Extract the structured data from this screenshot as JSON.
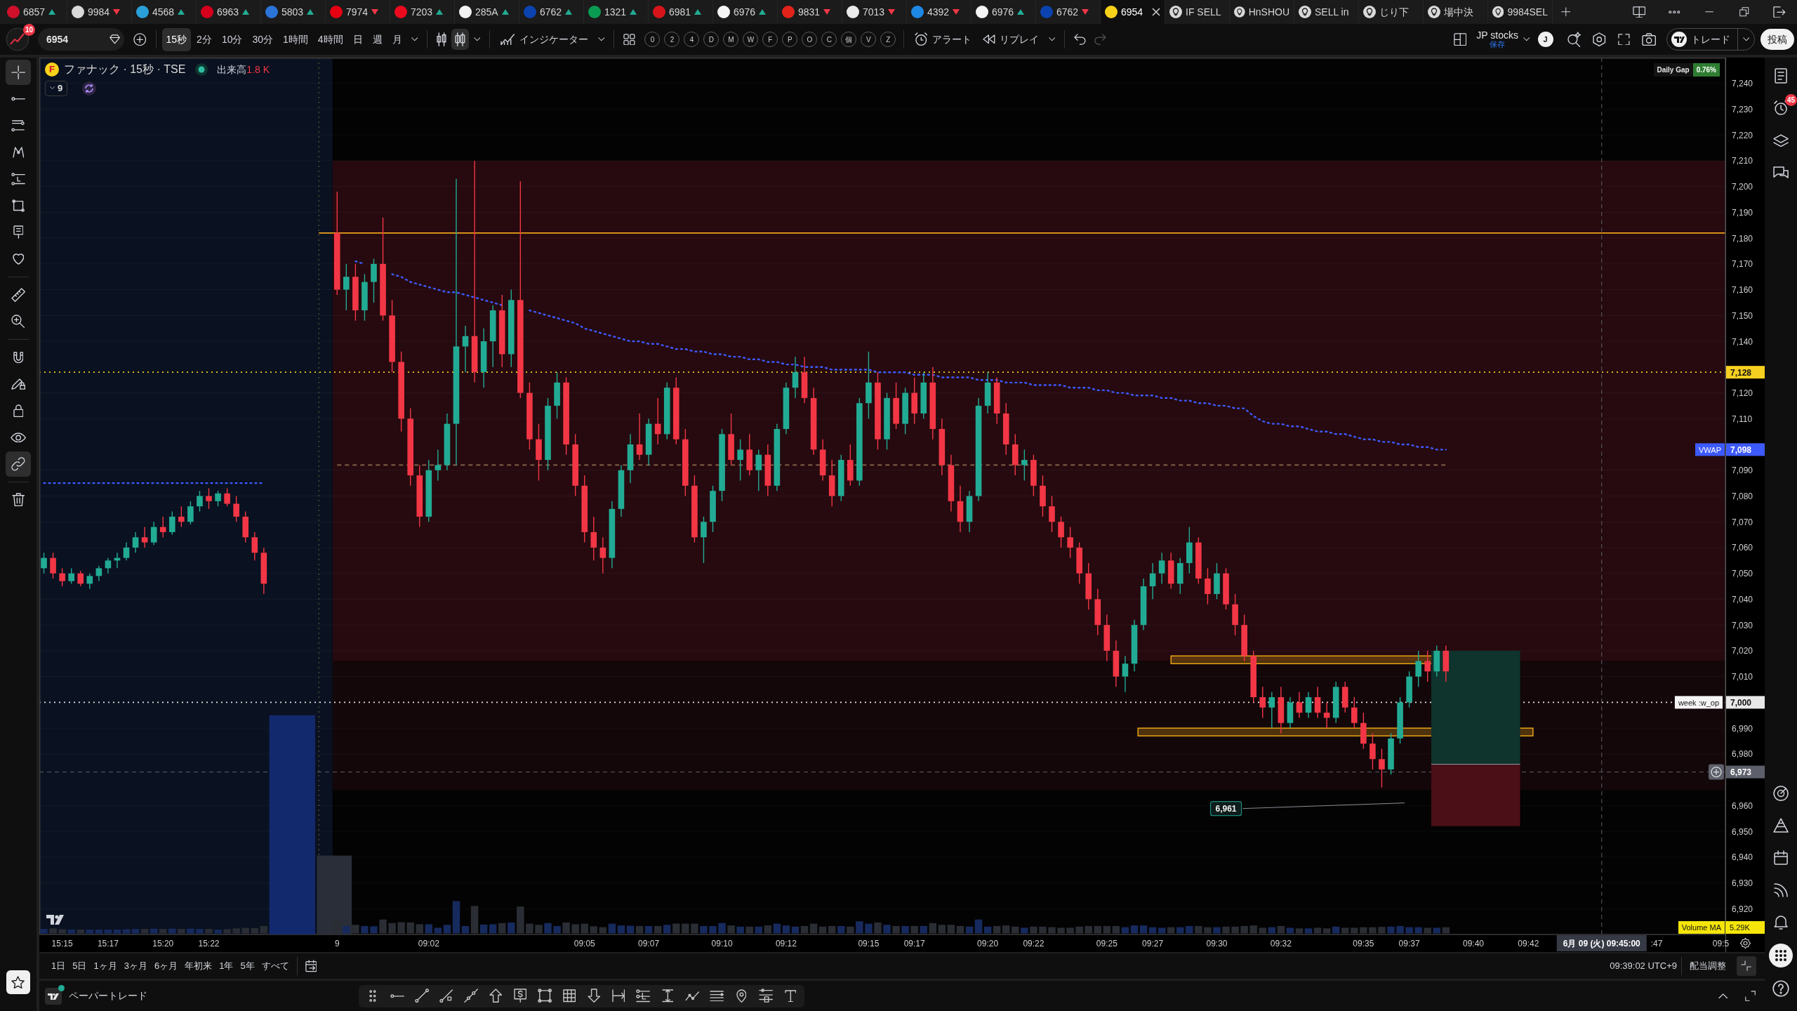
{
  "tabs": [
    {
      "kind": "symbol",
      "symbol": "6857",
      "rising": true,
      "color": "#d0102b",
      "selected": false
    },
    {
      "kind": "symbol",
      "symbol": "9984",
      "rising": false,
      "color": "#d9d9d9",
      "selected": false
    },
    {
      "kind": "symbol",
      "symbol": "4568",
      "rising": true,
      "color": "#2a9fd8",
      "selected": false
    },
    {
      "kind": "symbol",
      "symbol": "6963",
      "rising": true,
      "color": "#d6001c",
      "selected": false
    },
    {
      "kind": "symbol",
      "symbol": "5803",
      "rising": true,
      "color": "#2b74d8",
      "selected": false
    },
    {
      "kind": "symbol",
      "symbol": "7974",
      "rising": false,
      "color": "#e60012",
      "selected": false
    },
    {
      "kind": "symbol",
      "symbol": "7203",
      "rising": true,
      "color": "#eb0a1e",
      "selected": false
    },
    {
      "kind": "symbol",
      "symbol": "285A",
      "rising": true,
      "color": "#f2f2f2",
      "selected": false
    },
    {
      "kind": "symbol",
      "symbol": "6762",
      "rising": true,
      "color": "#0b43b0",
      "selected": false
    },
    {
      "kind": "symbol",
      "symbol": "1321",
      "rising": true,
      "color": "#0a9b52",
      "selected": false
    },
    {
      "kind": "symbol",
      "symbol": "6981",
      "rising": true,
      "color": "#d7141a",
      "selected": false
    },
    {
      "kind": "symbol",
      "symbol": "6976",
      "rising": true,
      "color": "#f5f5f5",
      "selected": false
    },
    {
      "kind": "symbol",
      "symbol": "9831",
      "rising": false,
      "color": "#e2231a",
      "selected": false
    },
    {
      "kind": "symbol",
      "symbol": "7013",
      "rising": false,
      "color": "#ebebeb",
      "selected": false
    },
    {
      "kind": "symbol",
      "symbol": "4392",
      "rising": false,
      "color": "#1e88e5",
      "selected": false
    },
    {
      "kind": "symbol",
      "symbol": "6976",
      "rising": true,
      "color": "#f5f5f5",
      "selected": false
    },
    {
      "kind": "symbol",
      "symbol": "6762",
      "rising": false,
      "color": "#0b43b0",
      "selected": false
    },
    {
      "kind": "symbol",
      "symbol": "6954",
      "color": "#f7d21b",
      "selected": true
    },
    {
      "kind": "layout",
      "title": "IF SELL",
      "selected": false
    },
    {
      "kind": "layout",
      "title": "HnSHOU",
      "selected": false
    },
    {
      "kind": "layout",
      "title": "SELL in",
      "selected": false
    },
    {
      "kind": "layout",
      "title": "じり下",
      "selected": false
    },
    {
      "kind": "layout",
      "title": "場中決",
      "selected": false
    },
    {
      "kind": "layout",
      "title": "9984SEL",
      "selected": false
    }
  ],
  "toolbar": {
    "profile_badge": "10",
    "symbol": "6954",
    "intervals": [
      {
        "label": "15秒",
        "selected": true
      },
      {
        "label": "2分",
        "selected": false
      },
      {
        "label": "10分",
        "selected": false
      },
      {
        "label": "30分",
        "selected": false
      },
      {
        "label": "1時間",
        "selected": false
      },
      {
        "label": "4時間",
        "selected": false
      },
      {
        "label": "日",
        "selected": false
      },
      {
        "label": "週",
        "selected": false
      },
      {
        "label": "月",
        "selected": false
      }
    ],
    "chart_types": [
      {
        "selected": false
      },
      {
        "selected": true
      }
    ],
    "indicators": "インジケーター",
    "favorites": [
      "0",
      "2",
      "4",
      "D",
      "M",
      "W",
      "F",
      "P",
      "O",
      "C",
      "個",
      "V",
      "Z"
    ],
    "alert": "アラート",
    "replay": "リプレイ",
    "undo": {
      "disabled": false
    },
    "redo": {
      "disabled": true
    },
    "layout_name": "JP stocks",
    "layout_status": "保存",
    "avatar": "J",
    "trade": "トレード",
    "publish": "投稿"
  },
  "drawing_tools": [
    {
      "selected": true
    },
    {
      "selected": false
    },
    {
      "selected": false
    },
    {
      "selected": false
    },
    {
      "selected": false
    },
    {
      "selected": false
    },
    {
      "selected": false
    },
    {
      "selected": false
    },
    {
      "selected": false
    },
    {
      "selected": false
    },
    {
      "selected": false
    },
    {
      "selected": false
    },
    {
      "selected": false
    },
    {
      "selected": false
    },
    {
      "selected": true
    },
    {
      "selected": false
    }
  ],
  "favorites_button": {
    "selected": true
  },
  "chart": {
    "logo": "F",
    "title": "ファナック · 15秒 · TSE",
    "market_open": true,
    "volume_label": "出来高",
    "volume_value": "1.8 K",
    "indicators_count": "9",
    "daily_gap": {
      "label": "Daily Gap",
      "value": "0.76%"
    },
    "volume_ma": {
      "label": "Volume MA",
      "value": "5.29K"
    },
    "chart_data": [
      {
        "type": "candlestick",
        "categories": [
          null,
          null,
          "15:15",
          null,
          null,
          null,
          null,
          "15:17",
          null,
          null,
          null,
          null,
          null,
          "15:20",
          null,
          null,
          null,
          null,
          "15:22",
          null,
          null,
          null,
          null,
          null,
          null,
          null,
          null,
          null,
          null,
          null,
          null,
          null,
          "9",
          null,
          null,
          null,
          null,
          null,
          null,
          null,
          null,
          null,
          "09:02",
          null,
          null,
          null,
          null,
          null,
          null,
          null,
          null,
          null,
          null,
          null,
          null,
          null,
          null,
          null,
          null,
          "09:05",
          null,
          null,
          null,
          null,
          null,
          null,
          "09:07",
          null,
          null,
          null,
          null,
          null,
          null,
          null,
          "09:10",
          null,
          null,
          null,
          null,
          null,
          null,
          "09:12",
          null,
          null,
          null,
          null,
          null,
          null,
          null,
          null,
          "09:15",
          null,
          null,
          null,
          null,
          "09:17",
          null,
          null,
          null,
          null,
          null,
          null,
          null,
          "09:20",
          null,
          null,
          null,
          null,
          "09:22",
          null,
          null,
          null,
          null,
          null,
          null,
          null,
          "09:25",
          null,
          null,
          null,
          null,
          "09:27",
          null,
          null,
          null,
          null,
          null,
          null,
          "09:30",
          null,
          null,
          null,
          null,
          null,
          null,
          "09:32",
          null,
          null,
          null,
          null,
          null,
          null,
          null,
          null,
          "09:35",
          null,
          null,
          null,
          null,
          "09:37",
          null,
          null,
          null,
          null,
          null,
          null,
          "09:40",
          null,
          null,
          null,
          null,
          null,
          "09:42",
          null,
          null,
          null,
          null,
          null,
          null,
          null,
          null,
          null,
          null,
          null,
          null,
          null,
          ":47",
          null,
          null,
          null,
          null,
          null,
          null,
          "09:5"
        ],
        "ohlc": [
          [
            7052,
            7058,
            7050,
            7056
          ],
          [
            7056,
            7058,
            7048,
            7050
          ],
          [
            7050,
            7052,
            7045,
            7047
          ],
          [
            7047,
            7052,
            7046,
            7050
          ],
          [
            7050,
            7051,
            7045,
            7046
          ],
          [
            7046,
            7050,
            7044,
            7049
          ],
          [
            7049,
            7053,
            7047,
            7052
          ],
          [
            7052,
            7056,
            7050,
            7055
          ],
          [
            7055,
            7058,
            7052,
            7056
          ],
          [
            7056,
            7062,
            7055,
            7060
          ],
          [
            7060,
            7066,
            7058,
            7064
          ],
          [
            7064,
            7068,
            7060,
            7062
          ],
          [
            7062,
            7070,
            7061,
            7068
          ],
          [
            7068,
            7072,
            7064,
            7066
          ],
          [
            7066,
            7074,
            7065,
            7072
          ],
          [
            7072,
            7076,
            7068,
            7070
          ],
          [
            7070,
            7078,
            7069,
            7076
          ],
          [
            7076,
            7082,
            7074,
            7080
          ],
          [
            7080,
            7083,
            7075,
            7078
          ],
          [
            7078,
            7082,
            7076,
            7081
          ],
          [
            7081,
            7083,
            7076,
            7077
          ],
          [
            7077,
            7080,
            7070,
            7072
          ],
          [
            7072,
            7074,
            7062,
            7064
          ],
          [
            7064,
            7066,
            7055,
            7058
          ],
          [
            7058,
            7060,
            7042,
            7046
          ],
          null,
          null,
          null,
          null,
          null,
          null,
          null,
          [
            7182,
            7198,
            7158,
            7160
          ],
          [
            7160,
            7170,
            7152,
            7165
          ],
          [
            7165,
            7170,
            7148,
            7152
          ],
          [
            7152,
            7166,
            7148,
            7163
          ],
          [
            7163,
            7172,
            7155,
            7170
          ],
          [
            7170,
            7188,
            7148,
            7150
          ],
          [
            7150,
            7156,
            7128,
            7132
          ],
          [
            7132,
            7136,
            7105,
            7110
          ],
          [
            7110,
            7114,
            7084,
            7088
          ],
          [
            7088,
            7092,
            7068,
            7072
          ],
          [
            7072,
            7094,
            7070,
            7090
          ],
          [
            7090,
            7098,
            7086,
            7092
          ],
          [
            7092,
            7112,
            7090,
            7108
          ],
          [
            7108,
            7203,
            7092,
            7138
          ],
          [
            7138,
            7146,
            7128,
            7142
          ],
          [
            7142,
            7210,
            7124,
            7128
          ],
          [
            7128,
            7145,
            7122,
            7140
          ],
          [
            7140,
            7154,
            7130,
            7152
          ],
          [
            7152,
            7158,
            7130,
            7135
          ],
          [
            7135,
            7160,
            7130,
            7156
          ],
          [
            7156,
            7202,
            7118,
            7120
          ],
          [
            7120,
            7124,
            7098,
            7102
          ],
          [
            7102,
            7108,
            7086,
            7094
          ],
          [
            7094,
            7118,
            7090,
            7115
          ],
          [
            7115,
            7128,
            7110,
            7124
          ],
          [
            7124,
            7126,
            7096,
            7100
          ],
          [
            7100,
            7104,
            7080,
            7084
          ],
          [
            7084,
            7088,
            7062,
            7066
          ],
          [
            7066,
            7072,
            7055,
            7060
          ],
          [
            7060,
            7064,
            7050,
            7056
          ],
          [
            7056,
            7078,
            7052,
            7075
          ],
          [
            7075,
            7092,
            7072,
            7090
          ],
          [
            7090,
            7104,
            7085,
            7100
          ],
          [
            7100,
            7112,
            7094,
            7096
          ],
          [
            7096,
            7110,
            7092,
            7108
          ],
          [
            7108,
            7118,
            7100,
            7104
          ],
          [
            7104,
            7124,
            7102,
            7122
          ],
          [
            7122,
            7126,
            7100,
            7102
          ],
          [
            7102,
            7106,
            7080,
            7084
          ],
          [
            7084,
            7088,
            7062,
            7064
          ],
          [
            7064,
            7072,
            7054,
            7070
          ],
          [
            7070,
            7084,
            7066,
            7082
          ],
          [
            7082,
            7106,
            7078,
            7104
          ],
          [
            7104,
            7112,
            7092,
            7094
          ],
          [
            7094,
            7102,
            7086,
            7098
          ],
          [
            7098,
            7104,
            7088,
            7090
          ],
          [
            7090,
            7098,
            7082,
            7096
          ],
          [
            7096,
            7100,
            7080,
            7084
          ],
          [
            7084,
            7108,
            7082,
            7106
          ],
          [
            7106,
            7124,
            7104,
            7122
          ],
          [
            7122,
            7134,
            7118,
            7128
          ],
          [
            7128,
            7134,
            7116,
            7118
          ],
          [
            7118,
            7122,
            7096,
            7098
          ],
          [
            7098,
            7102,
            7086,
            7088
          ],
          [
            7088,
            7094,
            7076,
            7080
          ],
          [
            7080,
            7096,
            7078,
            7094
          ],
          [
            7094,
            7100,
            7084,
            7086
          ],
          [
            7086,
            7118,
            7084,
            7116
          ],
          [
            7116,
            7136,
            7110,
            7124
          ],
          [
            7124,
            7128,
            7098,
            7102
          ],
          [
            7102,
            7120,
            7098,
            7118
          ],
          [
            7118,
            7124,
            7106,
            7108
          ],
          [
            7108,
            7122,
            7104,
            7120
          ],
          [
            7120,
            7126,
            7108,
            7112
          ],
          [
            7112,
            7128,
            7110,
            7124
          ],
          [
            7124,
            7130,
            7102,
            7106
          ],
          [
            7106,
            7110,
            7088,
            7092
          ],
          [
            7092,
            7096,
            7074,
            7078
          ],
          [
            7078,
            7084,
            7066,
            7070
          ],
          [
            7070,
            7082,
            7066,
            7080
          ],
          [
            7080,
            7118,
            7078,
            7115
          ],
          [
            7115,
            7128,
            7112,
            7124
          ],
          [
            7124,
            7126,
            7108,
            7112
          ],
          [
            7112,
            7116,
            7096,
            7100
          ],
          [
            7100,
            7104,
            7088,
            7092
          ],
          [
            7092,
            7098,
            7086,
            7094
          ],
          [
            7094,
            7096,
            7080,
            7084
          ],
          [
            7084,
            7088,
            7072,
            7076
          ],
          [
            7076,
            7080,
            7066,
            7070
          ],
          [
            7070,
            7072,
            7060,
            7064
          ],
          [
            7064,
            7068,
            7056,
            7060
          ],
          [
            7060,
            7062,
            7046,
            7050
          ],
          [
            7050,
            7054,
            7036,
            7040
          ],
          [
            7040,
            7044,
            7026,
            7030
          ],
          [
            7030,
            7034,
            7016,
            7020
          ],
          [
            7020,
            7024,
            7006,
            7010
          ],
          [
            7010,
            7018,
            7004,
            7015
          ],
          [
            7015,
            7032,
            7012,
            7030
          ],
          [
            7030,
            7048,
            7028,
            7045
          ],
          [
            7045,
            7054,
            7040,
            7050
          ],
          [
            7050,
            7058,
            7046,
            7055
          ],
          [
            7055,
            7058,
            7044,
            7046
          ],
          [
            7046,
            7056,
            7042,
            7054
          ],
          [
            7054,
            7068,
            7050,
            7062
          ],
          [
            7062,
            7064,
            7046,
            7048
          ],
          [
            7048,
            7052,
            7038,
            7042
          ],
          [
            7042,
            7054,
            7040,
            7050
          ],
          [
            7050,
            7052,
            7036,
            7038
          ],
          [
            7038,
            7042,
            7026,
            7030
          ],
          [
            7030,
            7034,
            7016,
            7018
          ],
          [
            7018,
            7020,
            7000,
            7002
          ],
          [
            7002,
            7006,
            6994,
            6998
          ],
          [
            6998,
            7004,
            6990,
            7002
          ],
          [
            7002,
            7006,
            6988,
            6992
          ],
          [
            6992,
            7002,
            6990,
            7000
          ],
          [
            7000,
            7004,
            6994,
            6996
          ],
          [
            6996,
            7004,
            6994,
            7002
          ],
          [
            7002,
            7006,
            6994,
            6996
          ],
          [
            6996,
            7000,
            6990,
            6994
          ],
          [
            6994,
            7008,
            6992,
            7006
          ],
          [
            7006,
            7008,
            6996,
            6998
          ],
          [
            6998,
            7002,
            6990,
            6992
          ],
          [
            6992,
            6996,
            6982,
            6984
          ],
          [
            6984,
            6988,
            6974,
            6978
          ],
          [
            6978,
            6982,
            6967,
            6974
          ],
          [
            6974,
            6988,
            6972,
            6986
          ],
          [
            6986,
            7002,
            6984,
            7000
          ],
          [
            7000,
            7012,
            6998,
            7010
          ],
          [
            7010,
            7020,
            7006,
            7016
          ],
          [
            7016,
            7020,
            7008,
            7012
          ],
          [
            7012,
            7022,
            7010,
            7020
          ],
          [
            7020,
            7022,
            7008,
            7012
          ],
          null,
          null,
          null,
          null,
          null,
          null,
          null,
          null,
          null,
          null,
          null,
          null,
          null,
          null,
          null,
          null,
          null,
          null,
          null,
          null,
          null,
          null,
          null,
          null,
          null,
          null,
          null,
          null,
          null,
          null
        ],
        "ylim": [
          6910,
          7250
        ],
        "yticks": [
          {
            "value": 7240,
            "label": "7,240"
          },
          {
            "value": 7230,
            "label": "7,230"
          },
          {
            "value": 7220,
            "label": "7,220"
          },
          {
            "value": 7210,
            "label": "7,210"
          },
          {
            "value": 7200,
            "label": "7,200"
          },
          {
            "value": 7190,
            "label": "7,190"
          },
          {
            "value": 7180,
            "label": "7,180"
          },
          {
            "value": 7170,
            "label": "7,170"
          },
          {
            "value": 7160,
            "label": "7,160"
          },
          {
            "value": 7150,
            "label": "7,150"
          },
          {
            "value": 7140,
            "label": "7,140"
          },
          {
            "value": 7120,
            "label": "7,120"
          },
          {
            "value": 7110,
            "label": "7,110"
          },
          {
            "value": 7090,
            "label": "7,090"
          },
          {
            "value": 7080,
            "label": "7,080"
          },
          {
            "value": 7070,
            "label": "7,070"
          },
          {
            "value": 7060,
            "label": "7,060"
          },
          {
            "value": 7050,
            "label": "7,050"
          },
          {
            "value": 7040,
            "label": "7,040"
          },
          {
            "value": 7030,
            "label": "7,030"
          },
          {
            "value": 7020,
            "label": "7,020"
          },
          {
            "value": 7010,
            "label": "7,010"
          },
          {
            "value": 6990,
            "label": "6,990"
          },
          {
            "value": 6980,
            "label": "6,980"
          },
          {
            "value": 6960,
            "label": "6,960"
          },
          {
            "value": 6950,
            "label": "6,950"
          },
          {
            "value": 6940,
            "label": "6,940"
          },
          {
            "value": 6930,
            "label": "6,930"
          },
          {
            "value": 6920,
            "label": "6,920"
          }
        ],
        "grid": true,
        "series": [
          {
            "name": "VWAP",
            "type": "line",
            "color": "#3d5afe",
            "line_style": "dotted",
            "values": [
              7085,
              7085,
              7085,
              7085,
              7085,
              7085,
              7085,
              7085,
              7085,
              7085,
              7085,
              7085,
              7085,
              7085,
              7085,
              7085,
              7085,
              7085,
              7085,
              7085,
              7085,
              7085,
              7085,
              7085,
              7085,
              null,
              null,
              null,
              null,
              null,
              null,
              null,
              null,
              null,
              7171,
              7170,
              null,
              null,
              7166,
              7165,
              7163,
              7162,
              7161,
              7160,
              7159,
              7159,
              7158,
              7157,
              7156,
              7155,
              7154,
              null,
              null,
              7152,
              7151,
              7150,
              7149,
              7148,
              7147,
              7145,
              7144,
              7143,
              7142,
              7141,
              7140,
              7140,
              7139,
              7139,
              7138,
              7137,
              7137,
              7136,
              7136,
              7135,
              7135,
              7134,
              7134,
              7133,
              7133,
              7132,
              7132,
              7131,
              7131,
              7130,
              7130,
              7130,
              7129,
              7129,
              7129,
              7129,
              7129,
              7128,
              7128,
              7128,
              7128,
              7127,
              7127,
              7127,
              7126,
              7126,
              7126,
              7126,
              7125,
              7125,
              7125,
              7124,
              7124,
              7124,
              7123,
              7123,
              7123,
              7123,
              7122,
              7122,
              7122,
              7121,
              7121,
              7120,
              7120,
              7119,
              7119,
              7119,
              7118,
              7118,
              7117,
              7117,
              7116,
              7116,
              7115,
              7115,
              7114,
              7114,
              7111,
              7109,
              7108,
              7108,
              7107,
              7107,
              7106,
              7105,
              7105,
              7104,
              7104,
              7103,
              7102,
              7102,
              7101,
              7101,
              7100,
              7100,
              7099,
              7099,
              7098,
              7098,
              null,
              null,
              null,
              null,
              null,
              null,
              null,
              null,
              null,
              null,
              null,
              null,
              null,
              null,
              null,
              null,
              null,
              null,
              null,
              null,
              null,
              null,
              null,
              null,
              null,
              null,
              null,
              null,
              null,
              null
            ]
          }
        ],
        "ref_lines": [
          {
            "axis": "y",
            "value": 7182,
            "color": "#f0a21a",
            "line_style": "solid"
          },
          {
            "axis": "y",
            "value": 7128,
            "color": "#f5d020",
            "line_style": "dotted",
            "label": "7,128"
          },
          {
            "axis": "y",
            "value": 7092,
            "color": "#8c6a4f",
            "line_style": "dashed"
          },
          {
            "axis": "y",
            "value": 7000,
            "color": "#e8e8e8",
            "line_style": "dotted",
            "label": "7,000"
          },
          {
            "axis": "y",
            "value": 6973,
            "color": "#5d606b",
            "line_style": "dashed",
            "label": "6,973"
          }
        ],
        "bands": [
          {
            "axis": "y",
            "from": 7016,
            "to": 7210,
            "color": "#260a0f"
          },
          {
            "axis": "y",
            "from": 6966,
            "to": 7016,
            "color": "#13070a"
          }
        ],
        "annotations": [
          "week :w_op",
          "7,098",
          "6,961",
          "6月 09 (火) 09:45:00"
        ]
      }
    ]
  },
  "right_sidebar": {
    "alerts_badge": "45"
  },
  "range_bar": {
    "ranges": [
      "1日",
      "5日",
      "1ヶ月",
      "3ヶ月",
      "6ヶ月",
      "年初来",
      "1年",
      "5年",
      "すべて"
    ],
    "clock": "09:39:02 UTC+9",
    "adjust": "配当調整"
  },
  "bottom_panel": {
    "title": "ペーパートレード",
    "connected": true
  }
}
